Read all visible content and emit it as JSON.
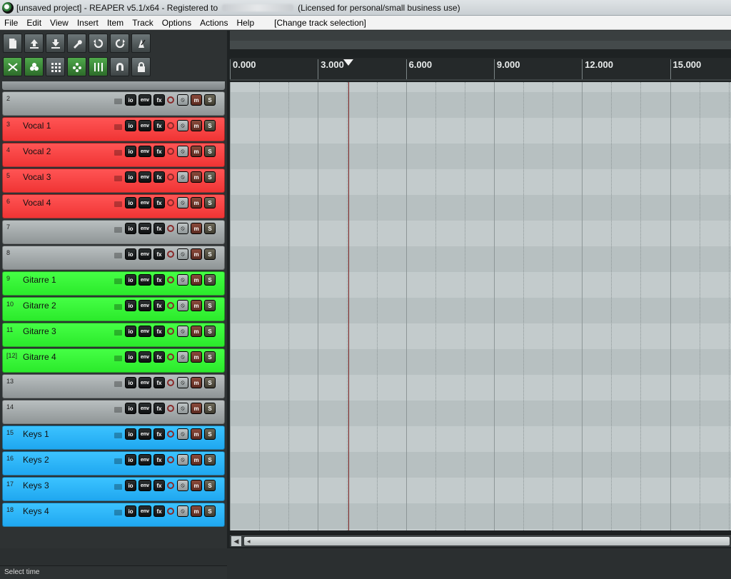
{
  "title_bar": {
    "project": "[unsaved project]",
    "app": "REAPER v5.1/x64 - Registered to",
    "license": "(Licensed for personal/small business use)"
  },
  "menu": {
    "items": [
      {
        "label": "File"
      },
      {
        "label": "Edit"
      },
      {
        "label": "View"
      },
      {
        "label": "Insert"
      },
      {
        "label": "Item"
      },
      {
        "label": "Track"
      },
      {
        "label": "Options"
      },
      {
        "label": "Actions"
      },
      {
        "label": "Help"
      }
    ],
    "special": "[Change track selection]"
  },
  "toolbar": {
    "buttons": [
      {
        "icon": "new-project-icon"
      },
      {
        "icon": "open-project-icon"
      },
      {
        "icon": "save-project-icon"
      },
      {
        "icon": "project-settings-icon"
      },
      {
        "icon": "undo-icon"
      },
      {
        "icon": "redo-icon"
      },
      {
        "icon": "metronome-icon"
      },
      {
        "icon": "auto-crossfade-icon"
      },
      {
        "icon": "envelope-points-icon"
      },
      {
        "icon": "snap-grid-icon"
      },
      {
        "icon": "ripple-edit-icon"
      },
      {
        "icon": "grid-lines-icon"
      },
      {
        "icon": "snapping-magnet-icon"
      },
      {
        "icon": "lock-icon"
      }
    ]
  },
  "tracks": [
    {
      "num": "2",
      "name": "",
      "color": "gray"
    },
    {
      "num": "3",
      "name": "Vocal 1",
      "color": "red"
    },
    {
      "num": "4",
      "name": "Vocal 2",
      "color": "red"
    },
    {
      "num": "5",
      "name": "Vocal 3",
      "color": "red"
    },
    {
      "num": "6",
      "name": "Vocal 4",
      "color": "red"
    },
    {
      "num": "7",
      "name": "",
      "color": "gray"
    },
    {
      "num": "8",
      "name": "",
      "color": "gray"
    },
    {
      "num": "9",
      "name": "Gitarre 1",
      "color": "green"
    },
    {
      "num": "10",
      "name": "Gitarre 2",
      "color": "green"
    },
    {
      "num": "11",
      "name": "Gitarre 3",
      "color": "green"
    },
    {
      "num": "[12]",
      "name": "Gitarre 4",
      "color": "green"
    },
    {
      "num": "13",
      "name": "",
      "color": "gray"
    },
    {
      "num": "14",
      "name": "",
      "color": "gray"
    },
    {
      "num": "15",
      "name": "Keys 1",
      "color": "blue"
    },
    {
      "num": "16",
      "name": "Keys 2",
      "color": "blue"
    },
    {
      "num": "17",
      "name": "Keys 3",
      "color": "blue"
    },
    {
      "num": "18",
      "name": "Keys 4",
      "color": "blue"
    }
  ],
  "track_buttons": {
    "io": "io",
    "env": "env",
    "fx": "fx",
    "mute": "m",
    "solo": "S"
  },
  "ruler": {
    "labels": [
      "0.000",
      "3.000",
      "6.000",
      "9.000",
      "12.000",
      "15.000"
    ]
  },
  "status": {
    "text": "Select time"
  },
  "colors": {
    "red": "#f64141",
    "green": "#36f536",
    "blue": "#2ab5f7",
    "gray": "#a4aaab",
    "lanes": "#c3cbcc",
    "lanes_alt": "#b7c0c1"
  }
}
